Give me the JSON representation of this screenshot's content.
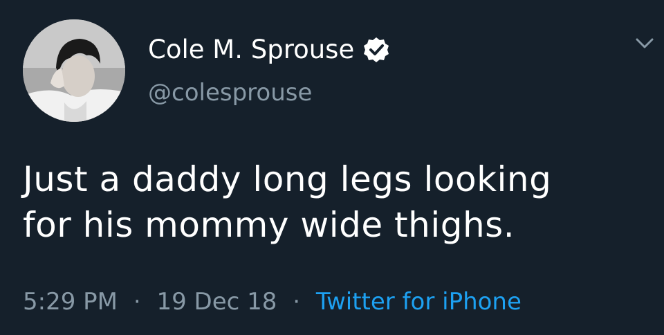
{
  "tweet": {
    "author": {
      "display_name": "Cole M. Sprouse",
      "handle": "@colesprouse",
      "verified": true,
      "verified_icon": "verified-badge-icon",
      "avatar": "profile-photo"
    },
    "menu_icon": "chevron-down-icon",
    "text_lines": [
      "Just a daddy long legs looking",
      "for his mommy wide thighs."
    ],
    "time": "5:29 PM",
    "separator": "·",
    "date": "19 Dec 18",
    "source": "Twitter for iPhone"
  },
  "colors": {
    "background": "#15202b",
    "primary_text": "#ffffff",
    "secondary_text": "#8899a6",
    "link": "#1da1f2"
  }
}
